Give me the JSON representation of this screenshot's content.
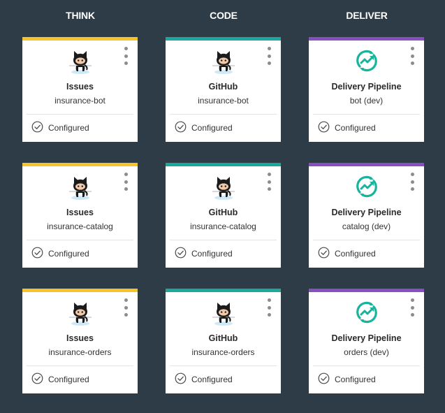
{
  "columns": [
    {
      "label": "THINK"
    },
    {
      "label": "CODE"
    },
    {
      "label": "DELIVER"
    }
  ],
  "colors": {
    "background": "#2d3c47",
    "think": "#f6c32b",
    "code": "#1aa79c",
    "deliver": "#8a4fbf",
    "pipeline_icon": "#18b39b"
  },
  "cards": [
    {
      "icon": "github-octocat-icon",
      "title": "Issues",
      "subtitle": "insurance-bot",
      "status": "Configured"
    },
    {
      "icon": "github-octocat-icon",
      "title": "GitHub",
      "subtitle": "insurance-bot",
      "status": "Configured"
    },
    {
      "icon": "delivery-pipeline-icon",
      "title": "Delivery Pipeline",
      "subtitle": "bot (dev)",
      "status": "Configured"
    },
    {
      "icon": "github-octocat-icon",
      "title": "Issues",
      "subtitle": "insurance-catalog",
      "status": "Configured"
    },
    {
      "icon": "github-octocat-icon",
      "title": "GitHub",
      "subtitle": "insurance-catalog",
      "status": "Configured"
    },
    {
      "icon": "delivery-pipeline-icon",
      "title": "Delivery Pipeline",
      "subtitle": "catalog (dev)",
      "status": "Configured"
    },
    {
      "icon": "github-octocat-icon",
      "title": "Issues",
      "subtitle": "insurance-orders",
      "status": "Configured"
    },
    {
      "icon": "github-octocat-icon",
      "title": "GitHub",
      "subtitle": "insurance-orders",
      "status": "Configured"
    },
    {
      "icon": "delivery-pipeline-icon",
      "title": "Delivery Pipeline",
      "subtitle": "orders (dev)",
      "status": "Configured"
    }
  ]
}
